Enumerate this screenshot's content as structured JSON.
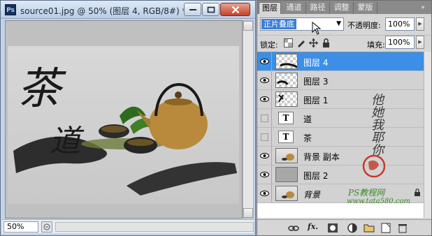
{
  "document": {
    "title": "source01.jpg @ 50% (图层 4, RGB/8#) *",
    "app_icon": "Ps",
    "zoom": "50%",
    "image_text_1": "茶",
    "image_text_2": "道"
  },
  "layers_panel": {
    "tabs": [
      {
        "label": "图层",
        "active": true
      },
      {
        "label": "通道",
        "active": false
      },
      {
        "label": "路径",
        "active": false
      },
      {
        "label": "调整",
        "active": false
      },
      {
        "label": "蒙版",
        "active": false
      }
    ],
    "menu_icon": "»",
    "blend_mode": "正片叠底",
    "opacity_label": "不透明度:",
    "opacity_value": "100%",
    "lock_label": "锁定:",
    "fill_label": "填充:",
    "fill_value": "100%",
    "layers": [
      {
        "name": "图层 4",
        "visible": true,
        "selected": true,
        "thumb": "checker"
      },
      {
        "name": "图层 3",
        "visible": true,
        "selected": false,
        "thumb": "checker"
      },
      {
        "name": "图层 1",
        "visible": true,
        "selected": false,
        "thumb": "checker"
      },
      {
        "name": "道",
        "visible": false,
        "selected": false,
        "thumb": "text"
      },
      {
        "name": "茶",
        "visible": false,
        "selected": false,
        "thumb": "text"
      },
      {
        "name": "背景 副本",
        "visible": true,
        "selected": false,
        "thumb": "photo"
      },
      {
        "name": "图层 2",
        "visible": true,
        "selected": false,
        "thumb": "gray"
      },
      {
        "name": "背景",
        "visible": true,
        "selected": false,
        "thumb": "photo",
        "locked": true
      }
    ],
    "text_thumb_glyph": "T",
    "watermark_signature": "他她我耶你",
    "watermark_site": "PS教程网",
    "watermark_url": "www.tata580.com",
    "fx_label": "fx."
  }
}
